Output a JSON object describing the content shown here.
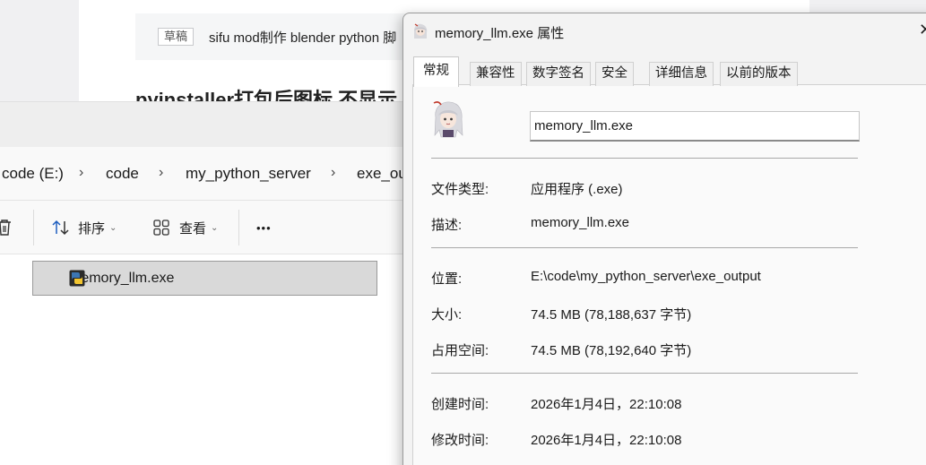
{
  "blog": {
    "draft_tag": "草稿",
    "draft_text": "sifu mod制作 blender python 脚",
    "title": "pyinstaller打包后图标 不显示"
  },
  "explorer": {
    "breadcrumbs": [
      "code (E:)",
      "code",
      "my_python_server",
      "exe_ou"
    ],
    "breadcrumb_separator": "›",
    "toolbar": {
      "sort_label": "排序",
      "view_label": "查看",
      "more_label": "•••"
    },
    "selected_file": "memory_llm.exe"
  },
  "dialog": {
    "title": "memory_llm.exe 属性",
    "close_label": "✕",
    "tabs": [
      "常规",
      "兼容性",
      "数字签名",
      "安全",
      "详细信息",
      "以前的版本"
    ],
    "active_tab": "常规",
    "file_name": "memory_llm.exe",
    "rows": [
      {
        "label": "文件类型:",
        "value": "应用程序 (.exe)"
      },
      {
        "label": "描述:",
        "value": "memory_llm.exe"
      },
      {
        "label": "位置:",
        "value": "E:\\code\\my_python_server\\exe_output"
      },
      {
        "label": "大小:",
        "value": "74.5 MB (78,188,637 字节)"
      },
      {
        "label": "占用空间:",
        "value": "74.5 MB (78,192,640 字节)"
      },
      {
        "label": "创建时间:",
        "value": "2026年1月4日，22:10:08"
      },
      {
        "label": "修改时间:",
        "value": "2026年1月4日，22:10:08"
      }
    ]
  },
  "icons": {
    "delete": "trash-icon",
    "sort": "sort-arrows-icon",
    "view": "grid-view-icon",
    "more": "more-options-icon",
    "file": "python-exe-icon",
    "app": "anime-character-icon"
  }
}
